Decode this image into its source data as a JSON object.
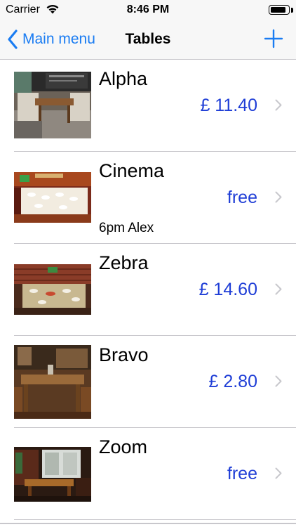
{
  "status_bar": {
    "carrier": "Carrier",
    "time": "8:46 PM",
    "battery_level": 0.9
  },
  "nav": {
    "back_label": "Main menu",
    "title": "Tables",
    "add_icon": "plus-icon",
    "back_icon": "chevron-left-icon",
    "accent_color": "#1a7cf2"
  },
  "tables": [
    {
      "name": "Alpha",
      "price": "£ 11.40",
      "note": "",
      "image": "lounge-table-photo"
    },
    {
      "name": "Cinema",
      "price": "free",
      "note": "6pm Alex",
      "image": "set-dining-table-photo"
    },
    {
      "name": "Zebra",
      "price": "£ 14.60",
      "note": "",
      "image": "brick-wall-dining-photo"
    },
    {
      "name": "Bravo",
      "price": "£ 2.80",
      "note": "",
      "image": "wooden-booth-photo"
    },
    {
      "name": "Zoom",
      "price": "free",
      "note": "",
      "image": "window-table-photo"
    }
  ],
  "colors": {
    "price_color": "#1e3dd6",
    "separator": "#c8c7cc"
  }
}
